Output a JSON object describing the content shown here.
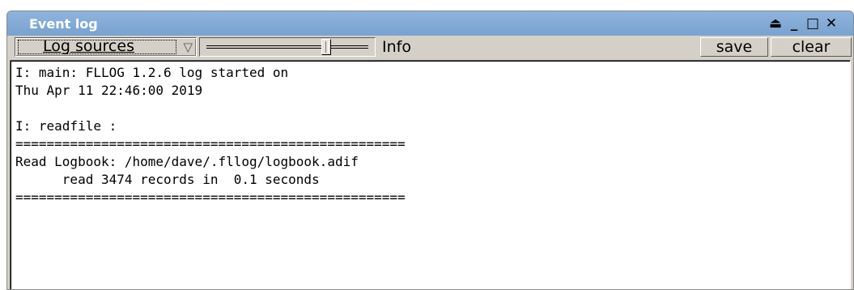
{
  "window": {
    "title": "Event log",
    "controls": {
      "shade": "⏏",
      "minimize": "_",
      "maximize": "□",
      "close": "✕"
    }
  },
  "toolbar": {
    "log_sources_label": "Log sources",
    "dropdown_arrow": "▽",
    "slider_label": "Info",
    "save_label": "save",
    "clear_label": "clear"
  },
  "log": {
    "lines": [
      "I: main: FLLOG 1.2.6 log started on",
      "Thu Apr 11 22:46:00 2019",
      "",
      "I: readfile :",
      "==================================================",
      "Read Logbook: /home/dave/.fllog/logbook.adif",
      "      read 3474 records in  0.1 seconds",
      "=================================================="
    ]
  }
}
